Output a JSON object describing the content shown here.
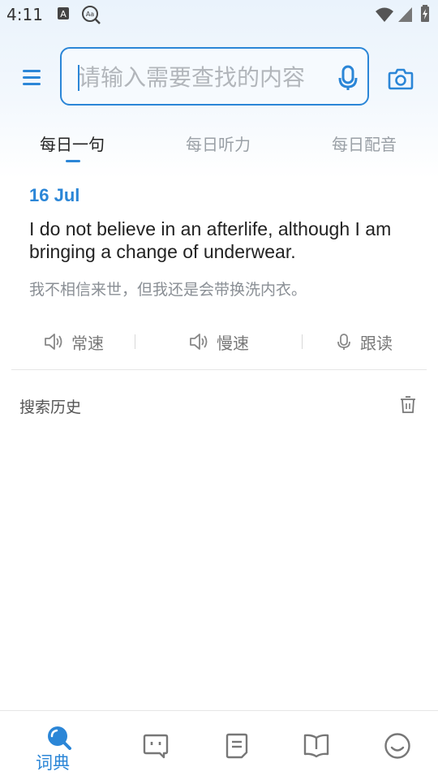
{
  "status_bar": {
    "time": "4:11",
    "icons": [
      "text-a-icon",
      "font-magnify-icon",
      "wifi-icon",
      "signal-icon",
      "battery-charging-icon"
    ]
  },
  "header": {
    "menu_icon": "hamburger-menu-icon",
    "search_placeholder": "请输入需要查找的内容",
    "search_value": "",
    "mic_icon": "microphone-icon",
    "camera_icon": "camera-icon"
  },
  "tabs": [
    {
      "label": "每日一句",
      "active": true
    },
    {
      "label": "每日听力",
      "active": false
    },
    {
      "label": "每日配音",
      "active": false
    }
  ],
  "daily": {
    "date": "16 Jul",
    "english": "I do not believe in an afterlife, although I am bringing a change of underwear.",
    "chinese": "我不相信来世，但我还是会带换洗内衣。",
    "actions": [
      {
        "label": "常速",
        "icon": "speaker-icon"
      },
      {
        "label": "慢速",
        "icon": "speaker-icon"
      },
      {
        "label": "跟读",
        "icon": "microphone-icon"
      }
    ]
  },
  "history": {
    "title": "搜索历史",
    "clear_icon": "trash-icon"
  },
  "bottom_nav": [
    {
      "label": "词典",
      "icon": "search-icon",
      "active": true
    },
    {
      "label": "",
      "icon": "chat-bubble-icon",
      "active": false
    },
    {
      "label": "",
      "icon": "document-icon",
      "active": false
    },
    {
      "label": "",
      "icon": "book-icon",
      "active": false
    },
    {
      "label": "",
      "icon": "smiley-icon",
      "active": false
    }
  ],
  "colors": {
    "accent": "#2b86d7",
    "muted": "#9aa0a6"
  }
}
